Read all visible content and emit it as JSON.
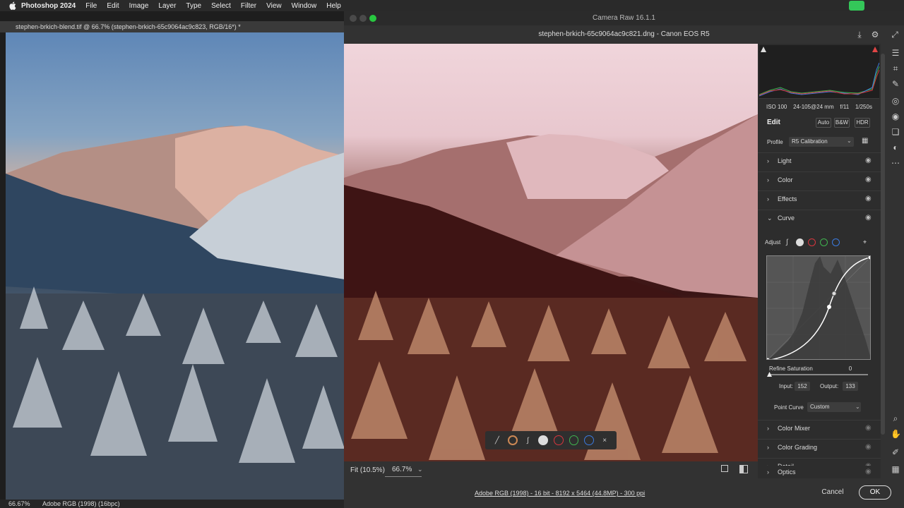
{
  "menubar": {
    "app_name": "Photoshop 2024",
    "items": [
      "File",
      "Edit",
      "Image",
      "Layer",
      "Type",
      "Select",
      "Filter",
      "View",
      "Window",
      "Help"
    ]
  },
  "photoshop": {
    "doc_tab": "stephen-brkich-blend.tif @ 66.7% (stephen-brkich-65c9064ac9c823, RGB/16*) *",
    "status_zoom": "66.67%",
    "status_profile": "Adobe RGB (1998) (16bpc)"
  },
  "camera_raw": {
    "window_title": "Camera Raw 16.1.1",
    "file_title": "stephen-brkich-65c9064ac9c821.dng  -  Canon EOS R5",
    "zoom": {
      "fit_label": "Fit (10.5%)",
      "value": "66.7%"
    },
    "image_info": "Adobe RGB (1998) - 16 bit - 8192 x 5464 (44.8MP) - 300 ppi",
    "cancel_label": "Cancel",
    "ok_label": "OK",
    "camera_info": {
      "iso": "ISO 100",
      "lens": "24-105@24 mm",
      "aperture": "f/11",
      "shutter": "1/250s"
    },
    "edit": {
      "title": "Edit",
      "auto_label": "Auto",
      "bw_label": "B&W",
      "hdr_label": "HDR",
      "profile_label": "Profile",
      "profile_value": "R5 Calibration"
    },
    "sections_top": [
      {
        "name": "Light",
        "chevron": "›"
      },
      {
        "name": "Color",
        "chevron": "›"
      },
      {
        "name": "Effects",
        "chevron": "›"
      },
      {
        "name": "Curve",
        "chevron": "⌄"
      }
    ],
    "curve": {
      "adjust_label": "Adjust",
      "refine_saturation_label": "Refine Saturation",
      "refine_saturation_value": "0",
      "input_label": "Input:",
      "input_value": "152",
      "output_label": "Output:",
      "output_value": "133",
      "point_curve_label": "Point Curve",
      "point_curve_value": "Custom"
    },
    "sections_bottom": [
      {
        "name": "Color Mixer",
        "chevron": "›"
      },
      {
        "name": "Color Grading",
        "chevron": "›"
      },
      {
        "name": "Detail",
        "chevron": "›"
      },
      {
        "name": "Optics",
        "chevron": "›"
      }
    ],
    "colors": {
      "channel_red": "#d9363e",
      "channel_green": "#3fb34f",
      "channel_blue": "#3b7be0",
      "traffic_red": "#ff5f57",
      "traffic_yellow": "#febc2e",
      "traffic_green": "#28c840"
    }
  }
}
